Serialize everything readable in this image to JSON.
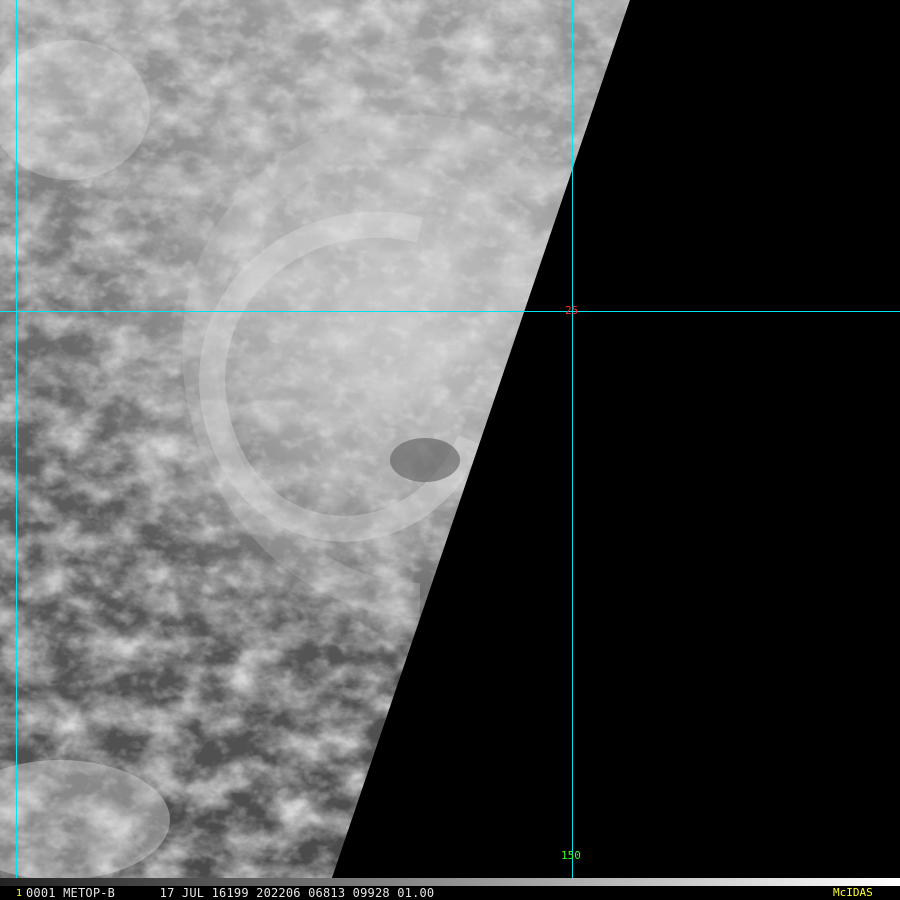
{
  "image": {
    "frame_number": "1",
    "header": "0001 METOP-B      17 JUL 16199 202206 06813 09928 01.00",
    "logo": "McIDAS"
  },
  "grid": {
    "lat_label": "25",
    "lon_label": "150",
    "line_color": "#00e5ee",
    "lat_label_color": "#ff3030",
    "lon_label_color": "#33ff33"
  },
  "colors": {
    "frame_number": "#ffff33",
    "logo": "#ffff33",
    "background": "#000000"
  }
}
